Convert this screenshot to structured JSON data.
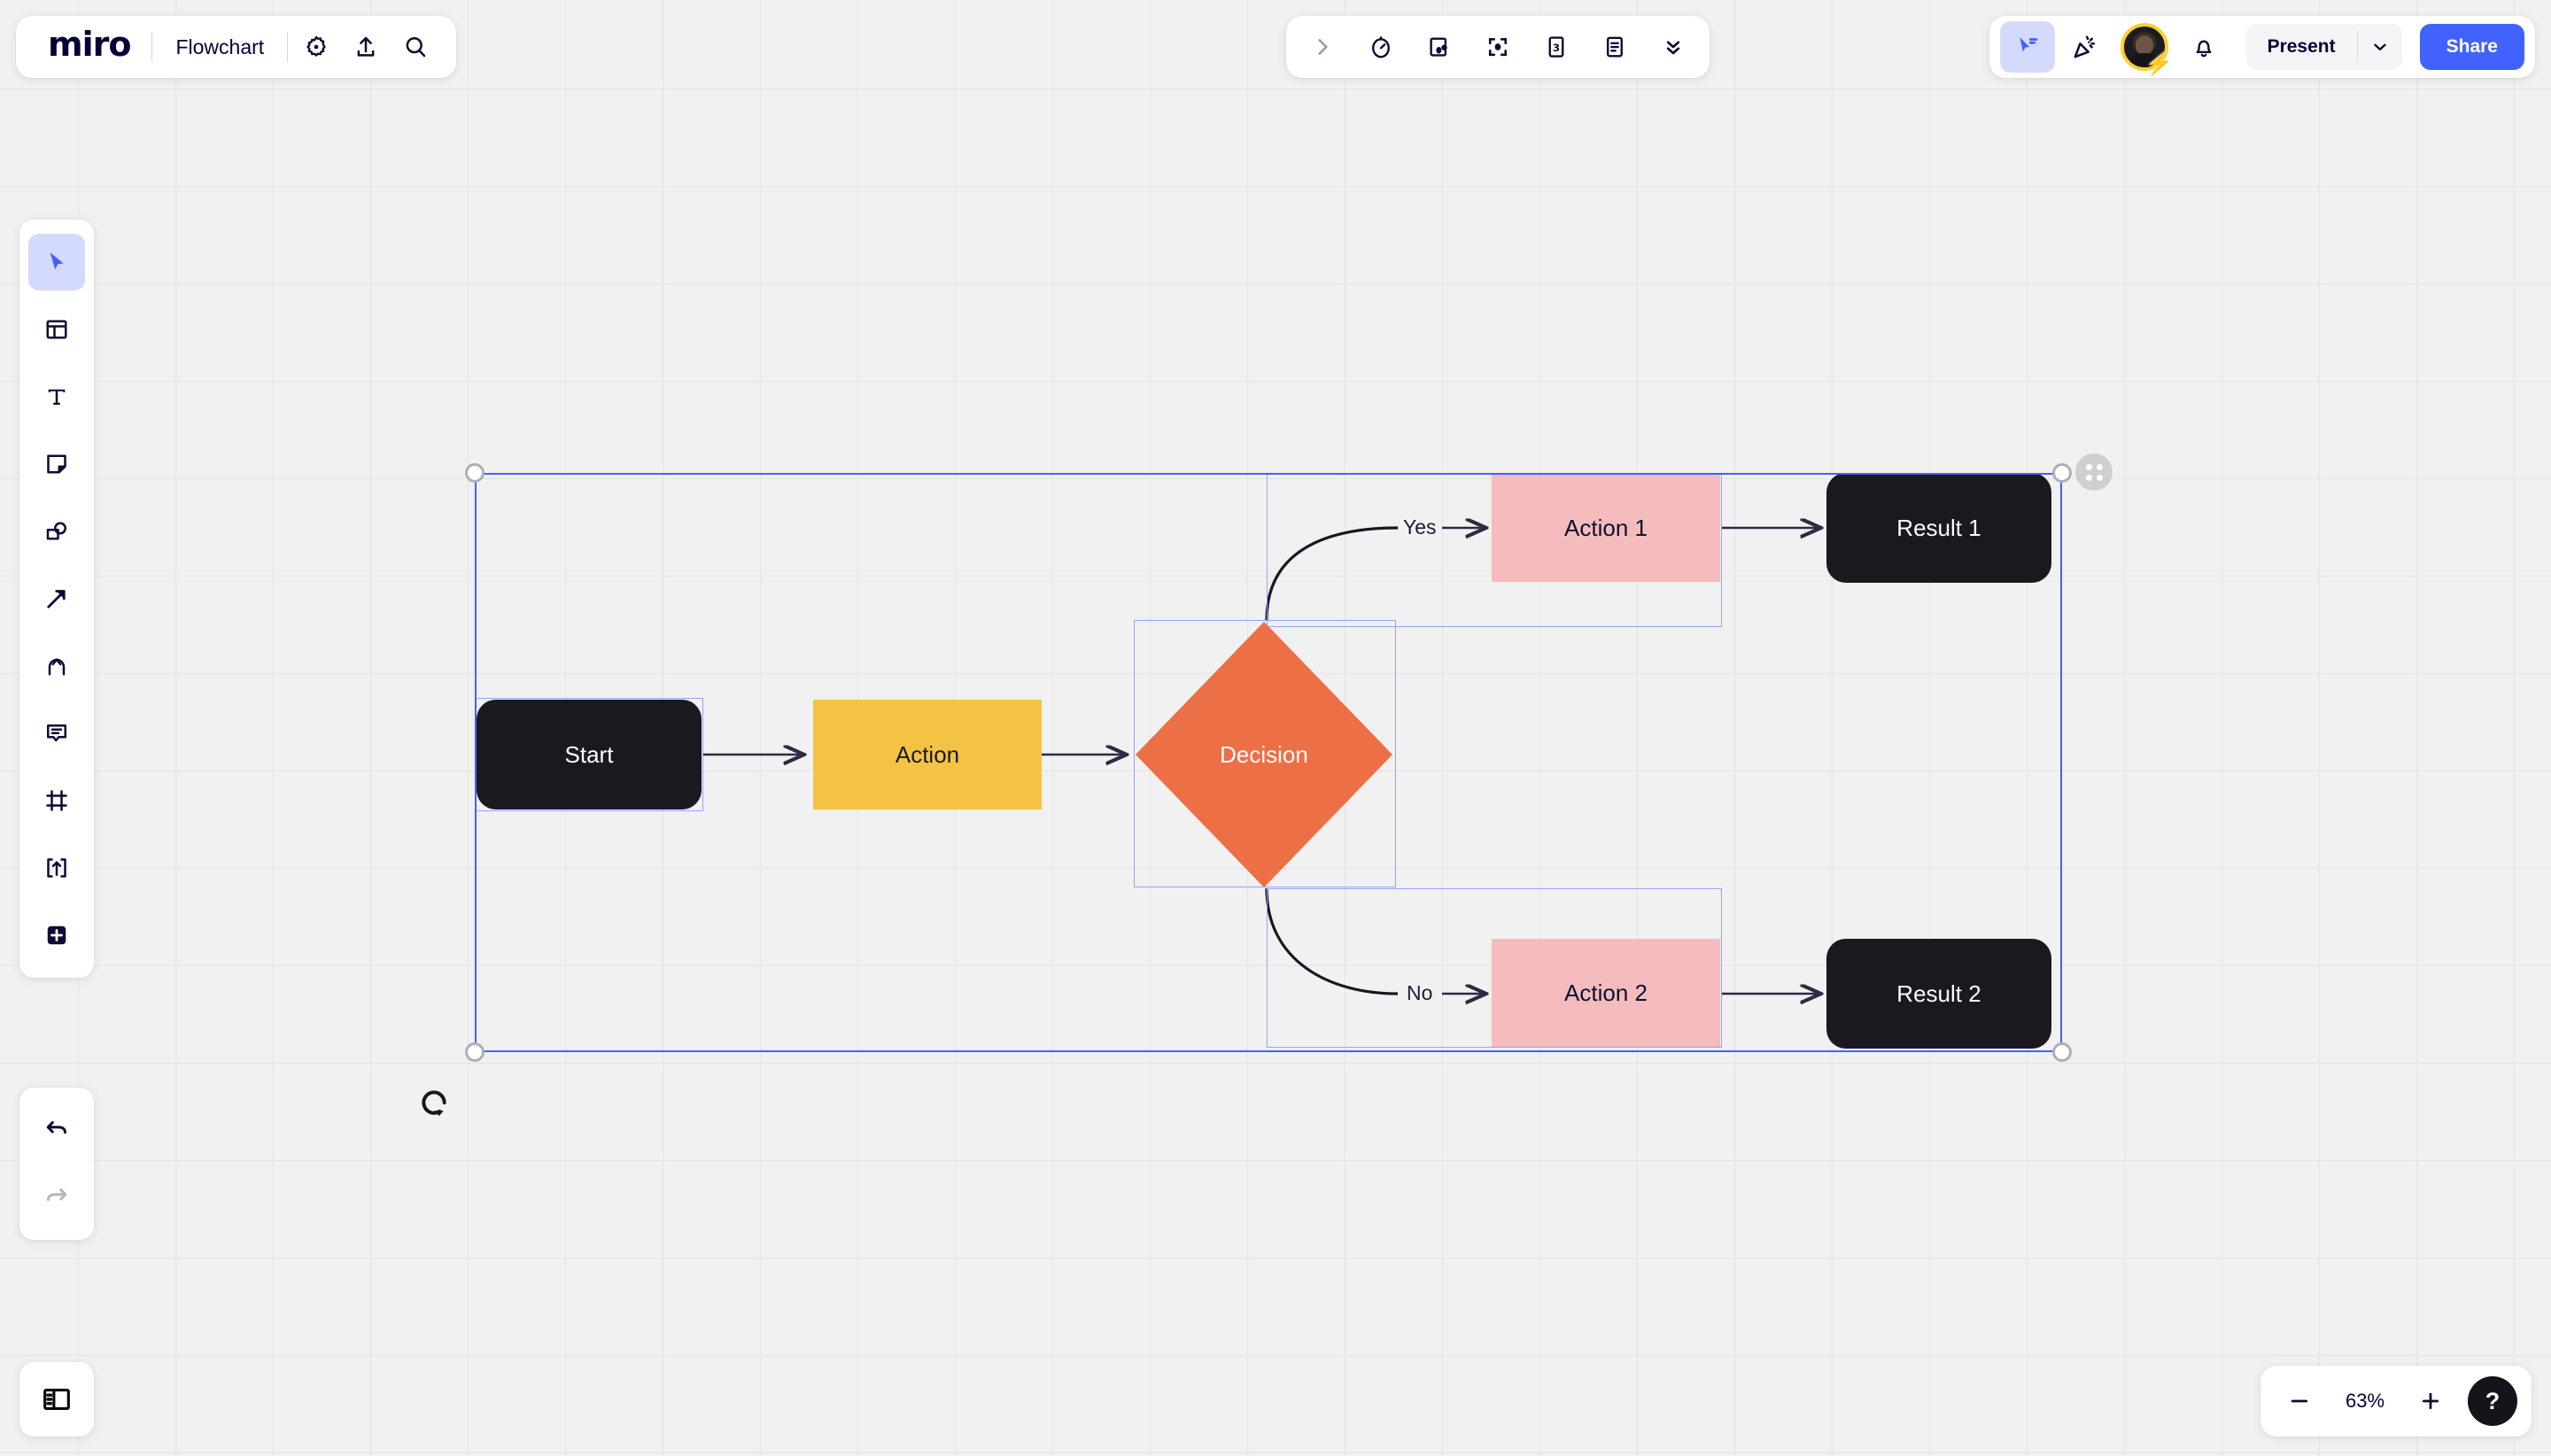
{
  "app": {
    "name": "miro",
    "board_title": "Flowchart"
  },
  "header_left": {
    "icons": [
      {
        "name": "settings-gear-icon",
        "label": "Settings"
      },
      {
        "name": "upload-icon",
        "label": "Upload"
      },
      {
        "name": "search-icon",
        "label": "Search"
      }
    ]
  },
  "header_center": {
    "icons": [
      {
        "name": "chevron-right-icon",
        "label": "Expand"
      },
      {
        "name": "timer-icon",
        "label": "Timer"
      },
      {
        "name": "media-icon",
        "label": "Media"
      },
      {
        "name": "focus-frame-icon",
        "label": "Focus mode"
      },
      {
        "name": "estimation-card-icon",
        "label": "Estimation",
        "badge": "3"
      },
      {
        "name": "notes-icon",
        "label": "Notes"
      },
      {
        "name": "chevron-double-down-icon",
        "label": "More"
      }
    ]
  },
  "header_right": {
    "cursor_tool": {
      "name": "collaboration-cursor-icon",
      "active": true
    },
    "celebrate": {
      "name": "party-popper-icon"
    },
    "avatar": {
      "name": "user-avatar",
      "badge": "upgrade-bolt"
    },
    "notifications": {
      "name": "bell-icon"
    },
    "present_label": "Present",
    "present_caret": "chevron-down-icon",
    "share_label": "Share"
  },
  "toolbar_left": {
    "items": [
      {
        "name": "select-tool",
        "icon": "cursor-arrow-icon",
        "selected": true
      },
      {
        "name": "templates-tool",
        "icon": "templates-icon",
        "selected": false
      },
      {
        "name": "text-tool",
        "icon": "text-t-icon",
        "selected": false
      },
      {
        "name": "sticky-note-tool",
        "icon": "sticky-note-icon",
        "selected": false
      },
      {
        "name": "shapes-tool",
        "icon": "shapes-icon",
        "selected": false
      },
      {
        "name": "connector-tool",
        "icon": "arrow-connector-icon",
        "selected": false
      },
      {
        "name": "pen-tool",
        "icon": "pen-curve-icon",
        "selected": false
      },
      {
        "name": "comment-tool",
        "icon": "comment-bubble-icon",
        "selected": false
      },
      {
        "name": "frame-tool",
        "icon": "frame-icon",
        "selected": false
      },
      {
        "name": "upload-tool",
        "icon": "upload-box-icon",
        "selected": false
      },
      {
        "name": "more-apps-tool",
        "icon": "plus-square-icon",
        "selected": false
      }
    ],
    "history": [
      {
        "name": "undo-button",
        "icon": "undo-arrow-icon",
        "enabled": true
      },
      {
        "name": "redo-button",
        "icon": "redo-arrow-icon",
        "enabled": false
      }
    ]
  },
  "panel_toggle": {
    "name": "sidebar-toggle",
    "icon": "sidebar-panel-icon"
  },
  "zoom_bar": {
    "minus_label": "−",
    "value": "63%",
    "plus_label": "+",
    "help_label": "?"
  },
  "canvas": {
    "selection": {
      "active": true,
      "handle_count": 4
    },
    "nodes": [
      {
        "id": "start",
        "label": "Start",
        "shape": "rounded-rect",
        "color": "#19191f",
        "text_color": "#ffffff"
      },
      {
        "id": "action",
        "label": "Action",
        "shape": "rect",
        "color": "#f5c344",
        "text_color": "#19191f"
      },
      {
        "id": "decision",
        "label": "Decision",
        "shape": "diamond",
        "color": "#ed6f46",
        "text_color": "#ffffff"
      },
      {
        "id": "action1",
        "label": "Action 1",
        "shape": "rect",
        "color": "#f4bcbc",
        "text_color": "#0d1033"
      },
      {
        "id": "action2",
        "label": "Action 2",
        "shape": "rect",
        "color": "#f4bcbc",
        "text_color": "#0d1033"
      },
      {
        "id": "result1",
        "label": "Result 1",
        "shape": "rounded-rect",
        "color": "#19191f",
        "text_color": "#ffffff"
      },
      {
        "id": "result2",
        "label": "Result 2",
        "shape": "rounded-rect",
        "color": "#19191f",
        "text_color": "#ffffff"
      }
    ],
    "edges": [
      {
        "from": "start",
        "to": "action",
        "label": ""
      },
      {
        "from": "action",
        "to": "decision",
        "label": ""
      },
      {
        "from": "decision",
        "to": "action1",
        "label": "Yes"
      },
      {
        "from": "decision",
        "to": "action2",
        "label": "No"
      },
      {
        "from": "action1",
        "to": "result1",
        "label": ""
      },
      {
        "from": "action2",
        "to": "result2",
        "label": ""
      }
    ],
    "labels": {
      "yes": "Yes",
      "no": "No"
    }
  },
  "colors": {
    "brand_blue": "#4262ff",
    "selection_blue": "#4262ff",
    "selection_box": "#8fa5f5",
    "canvas_bg": "#f1f1f1",
    "grid_line": "#e4e4e4",
    "dark_node": "#19191f",
    "yellow_node": "#f5c344",
    "pink_node": "#f4bcbc",
    "orange_node": "#ed6f46",
    "ink": "#050038"
  }
}
